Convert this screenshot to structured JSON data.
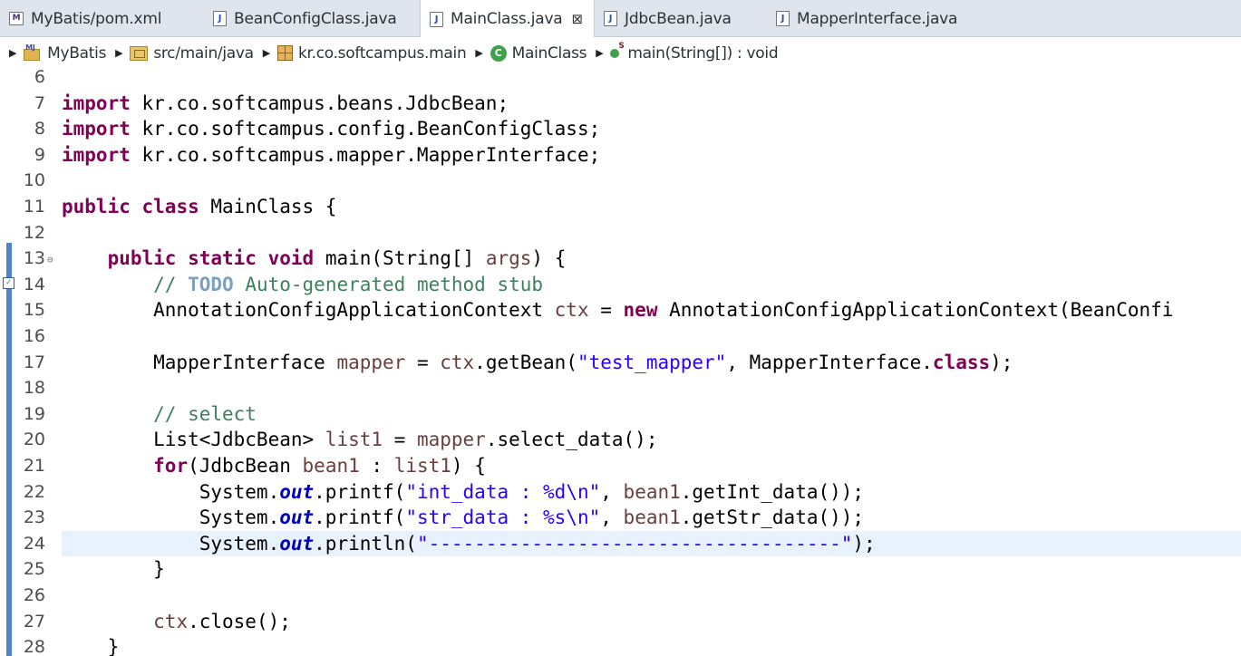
{
  "tabs": [
    {
      "label": "MyBatis/pom.xml",
      "icon": "maven-file-icon",
      "active": false
    },
    {
      "label": "BeanConfigClass.java",
      "icon": "java-file-icon",
      "active": false
    },
    {
      "label": "MainClass.java",
      "icon": "java-file-icon",
      "active": true
    },
    {
      "label": "JdbcBean.java",
      "icon": "java-file-icon",
      "active": false
    },
    {
      "label": "MapperInterface.java",
      "icon": "java-file-icon",
      "active": false
    }
  ],
  "tab_close_glyph": "⊠",
  "breadcrumb": {
    "project": "MyBatis",
    "source_folder": "src/main/java",
    "package": "kr.co.softcampus.main",
    "class": "MainClass",
    "method": "main(String[]) : void"
  },
  "editor": {
    "current_line": 24,
    "lines": [
      {
        "n": "6",
        "parts": []
      },
      {
        "n": "7",
        "parts": [
          {
            "t": "import",
            "c": "kw"
          },
          {
            "t": " kr.co.softcampus.beans.JdbcBean;"
          }
        ]
      },
      {
        "n": "8",
        "parts": [
          {
            "t": "import",
            "c": "kw"
          },
          {
            "t": " kr.co.softcampus.config.BeanConfigClass;"
          }
        ]
      },
      {
        "n": "9",
        "parts": [
          {
            "t": "import",
            "c": "kw"
          },
          {
            "t": " kr.co.softcampus.mapper.MapperInterface;"
          }
        ]
      },
      {
        "n": "10",
        "parts": []
      },
      {
        "n": "11",
        "parts": [
          {
            "t": "public",
            "c": "kw"
          },
          {
            "t": " "
          },
          {
            "t": "class",
            "c": "kw"
          },
          {
            "t": " MainClass {"
          }
        ]
      },
      {
        "n": "12",
        "parts": []
      },
      {
        "n": "13",
        "fold": true,
        "parts": [
          {
            "t": "    "
          },
          {
            "t": "public",
            "c": "kw"
          },
          {
            "t": " "
          },
          {
            "t": "static",
            "c": "kw"
          },
          {
            "t": " "
          },
          {
            "t": "void",
            "c": "kw"
          },
          {
            "t": " main(String[] "
          },
          {
            "t": "args",
            "c": "var"
          },
          {
            "t": ") {"
          }
        ]
      },
      {
        "n": "14",
        "task": true,
        "parts": [
          {
            "t": "        "
          },
          {
            "t": "// ",
            "c": "cm"
          },
          {
            "t": "TODO",
            "c": "todo"
          },
          {
            "t": " Auto-generated method stub",
            "c": "cm"
          }
        ]
      },
      {
        "n": "15",
        "parts": [
          {
            "t": "        AnnotationConfigApplicationContext "
          },
          {
            "t": "ctx",
            "c": "var"
          },
          {
            "t": " = "
          },
          {
            "t": "new",
            "c": "kw"
          },
          {
            "t": " AnnotationConfigApplicationContext(BeanConfi"
          }
        ]
      },
      {
        "n": "16",
        "parts": []
      },
      {
        "n": "17",
        "parts": [
          {
            "t": "        MapperInterface "
          },
          {
            "t": "mapper",
            "c": "var"
          },
          {
            "t": " = "
          },
          {
            "t": "ctx",
            "c": "var"
          },
          {
            "t": ".getBean("
          },
          {
            "t": "\"test_mapper\"",
            "c": "str"
          },
          {
            "t": ", MapperInterface."
          },
          {
            "t": "class",
            "c": "kw"
          },
          {
            "t": ");"
          }
        ]
      },
      {
        "n": "18",
        "parts": []
      },
      {
        "n": "19",
        "parts": [
          {
            "t": "        "
          },
          {
            "t": "// select",
            "c": "cm"
          }
        ]
      },
      {
        "n": "20",
        "parts": [
          {
            "t": "        List<JdbcBean> "
          },
          {
            "t": "list1",
            "c": "var"
          },
          {
            "t": " = "
          },
          {
            "t": "mapper",
            "c": "var"
          },
          {
            "t": ".select_data();"
          }
        ]
      },
      {
        "n": "21",
        "parts": [
          {
            "t": "        "
          },
          {
            "t": "for",
            "c": "kw"
          },
          {
            "t": "(JdbcBean "
          },
          {
            "t": "bean1",
            "c": "var"
          },
          {
            "t": " : "
          },
          {
            "t": "list1",
            "c": "var"
          },
          {
            "t": ") {"
          }
        ]
      },
      {
        "n": "22",
        "parts": [
          {
            "t": "            System."
          },
          {
            "t": "out",
            "c": "fld"
          },
          {
            "t": ".printf("
          },
          {
            "t": "\"int_data : %d\\n\"",
            "c": "str"
          },
          {
            "t": ", "
          },
          {
            "t": "bean1",
            "c": "var"
          },
          {
            "t": ".getInt_data());"
          }
        ]
      },
      {
        "n": "23",
        "parts": [
          {
            "t": "            System."
          },
          {
            "t": "out",
            "c": "fld"
          },
          {
            "t": ".printf("
          },
          {
            "t": "\"str_data : %s\\n\"",
            "c": "str"
          },
          {
            "t": ", "
          },
          {
            "t": "bean1",
            "c": "var"
          },
          {
            "t": ".getStr_data());"
          }
        ]
      },
      {
        "n": "24",
        "parts": [
          {
            "t": "            System."
          },
          {
            "t": "out",
            "c": "fld"
          },
          {
            "t": ".println("
          },
          {
            "t": "\"------------------------------------\"",
            "c": "str"
          },
          {
            "t": ");"
          }
        ]
      },
      {
        "n": "25",
        "parts": [
          {
            "t": "        }"
          }
        ]
      },
      {
        "n": "26",
        "parts": []
      },
      {
        "n": "27",
        "parts": [
          {
            "t": "        "
          },
          {
            "t": "ctx",
            "c": "var"
          },
          {
            "t": ".close();"
          }
        ]
      },
      {
        "n": "28",
        "parts": [
          {
            "t": "    }"
          }
        ]
      }
    ]
  }
}
